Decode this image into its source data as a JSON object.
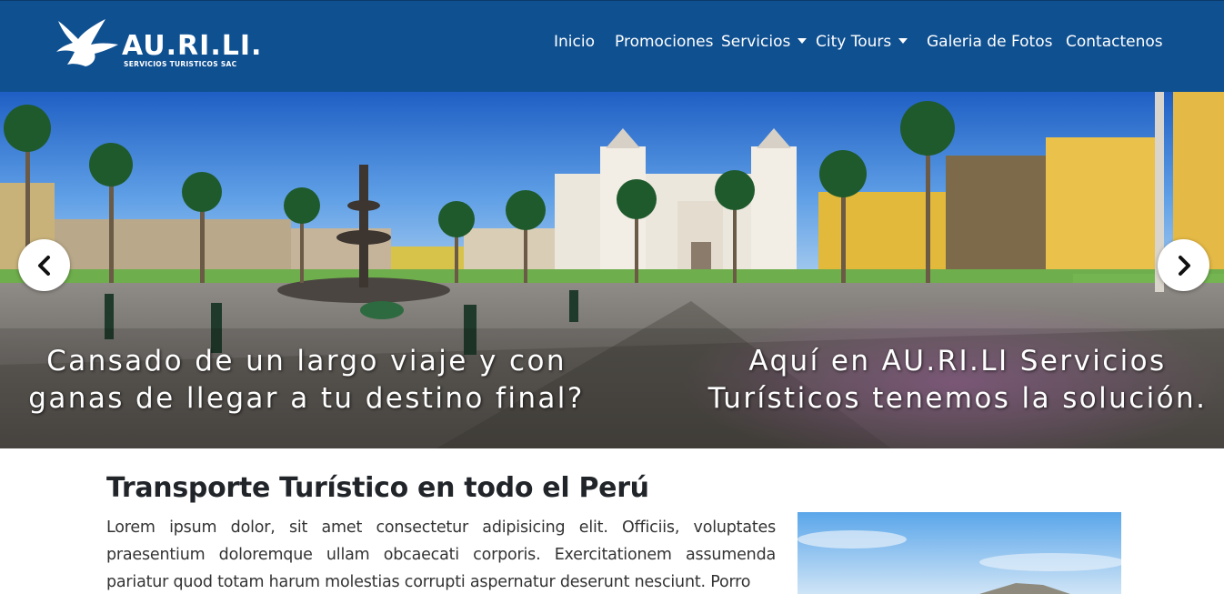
{
  "brand": {
    "name": "AU.RI.LI.",
    "subtitle": "SERVICIOS TURISTICOS SAC",
    "color": "#0f5091"
  },
  "nav": {
    "items": [
      {
        "label": "Inicio",
        "dropdown": false
      },
      {
        "label": "Promociones",
        "dropdown": false
      },
      {
        "label": "Servicios",
        "dropdown": true
      },
      {
        "label": "City Tours",
        "dropdown": true
      },
      {
        "label": "Galeria de Fotos",
        "dropdown": false
      },
      {
        "label": "Contactenos",
        "dropdown": false
      }
    ]
  },
  "hero": {
    "caption_left": "Cansado de un largo viaje y con ganas de llegar a tu destino final?",
    "caption_right": "Aquí en AU.RI.LI Servicios Turísticos tenemos la solución.",
    "prev_icon": "chevron-left-icon",
    "next_icon": "chevron-right-icon"
  },
  "content": {
    "title": "Transporte Turístico en todo el Perú",
    "body": "Lorem ipsum dolor, sit amet consectetur adipisicing elit. Officiis, voluptates praesentium doloremque ullam obcaecati corporis. Exercitationem assumenda pariatur quod totam harum molestias corrupti aspernatur deserunt nesciunt. Porro"
  }
}
